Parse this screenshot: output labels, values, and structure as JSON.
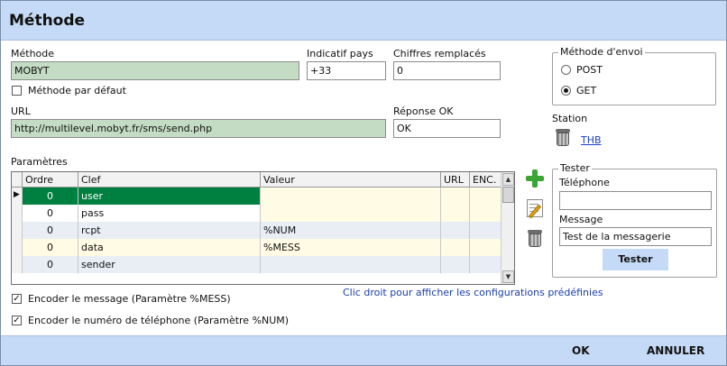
{
  "window": {
    "title": "Méthode"
  },
  "form": {
    "methode": {
      "label": "Méthode",
      "value": "MOBYT"
    },
    "indicatif": {
      "label": "Indicatif pays",
      "value": "+33"
    },
    "chiffres": {
      "label": "Chiffres remplacés",
      "value": "0"
    },
    "default_method": {
      "label": "Méthode par défaut",
      "checked": false
    },
    "url": {
      "label": "URL",
      "value": "http://multilevel.mobyt.fr/sms/send.php"
    },
    "reponse": {
      "label": "Réponse OK",
      "value": "OK"
    }
  },
  "envoi": {
    "title": "Méthode d'envoi",
    "options": [
      {
        "label": "POST",
        "selected": false
      },
      {
        "label": "GET",
        "selected": true
      }
    ]
  },
  "station": {
    "label": "Station",
    "link": "THB"
  },
  "params": {
    "label": "Paramètres",
    "columns": [
      "Ordre",
      "Clef",
      "Valeur",
      "URL",
      "ENC."
    ],
    "rows": [
      {
        "ordre": "0",
        "clef": "user",
        "valeur": ""
      },
      {
        "ordre": "0",
        "clef": "pass",
        "valeur": ""
      },
      {
        "ordre": "0",
        "clef": "rcpt",
        "valeur": "%NUM"
      },
      {
        "ordre": "0",
        "clef": "data",
        "valeur": "%MESS"
      },
      {
        "ordre": "0",
        "clef": "sender",
        "valeur": ""
      }
    ],
    "hint": "Clic droit pour afficher les configurations prédéfinies"
  },
  "options": {
    "encode_message": {
      "label": "Encoder le message (Paramètre %MESS)",
      "checked": true
    },
    "encode_numero": {
      "label": "Encoder le numéro de téléphone (Paramètre %NUM)",
      "checked": true
    }
  },
  "tester": {
    "title": "Tester",
    "telephone_label": "Téléphone",
    "telephone_value": "",
    "message_label": "Message",
    "message_value": "Test de la messagerie",
    "button": "Tester"
  },
  "footer": {
    "ok": "OK",
    "cancel": "ANNULER"
  },
  "colors": {
    "accent": "#c5daf6",
    "selected_row": "#008040",
    "field_green": "#c4dcc4",
    "row_alt": "#fffbe4",
    "link": "#1a3fd0"
  },
  "icons": {
    "add": "plus-icon",
    "edit": "edit-icon",
    "delete": "trash-icon"
  }
}
